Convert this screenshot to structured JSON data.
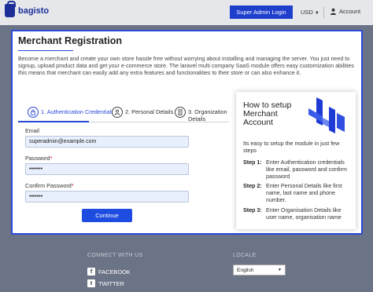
{
  "header": {
    "logo_text": "bagisto",
    "admin_button": "Super Admin Login",
    "currency": "USD",
    "account": "Account"
  },
  "main": {
    "title": "Merchant Registration",
    "intro": "Become a merchant and create your own store hassle free without worrying about installing and managing the server. You just need to signup, upload product data and get your e-commerce store. The laravel multi company SaaS module offers easy customization abilities this means that merchant can easily add any extra features and functionalities to their store or can also enhance it.",
    "steps": [
      {
        "number": "1.",
        "label": "Authentication Credentials"
      },
      {
        "number": "2.",
        "label": "Personal Details"
      },
      {
        "number": "3.",
        "label": "Organization Details"
      }
    ],
    "form": {
      "email_label": "Email",
      "email_value": "superadmin@example.com",
      "password_label": "Password",
      "password_value": "•••••••",
      "confirm_label": "Confirm Password",
      "confirm_value": "•••••••",
      "required_mark": "*",
      "continue_label": "Continue"
    }
  },
  "setup": {
    "title": "How to setup Merchant Account",
    "description": "Its easy to setup the module in just few steps",
    "steps": [
      {
        "num": "Step 1:",
        "text": "Enter Authentication credentials like email, password and confirm password"
      },
      {
        "num": "Step 2:",
        "text": "Enter Personal Details like first name, last name and phone number."
      },
      {
        "num": "Step 3:",
        "text": "Enter Organisation Details like user name, organisation name"
      }
    ],
    "accent_color": "#2a48d8"
  },
  "footer": {
    "connect_title": "CONNECT WITH US",
    "facebook": "FACEBOOK",
    "twitter": "TWITTER",
    "locale_title": "LOCALE",
    "locale_value": "English"
  }
}
